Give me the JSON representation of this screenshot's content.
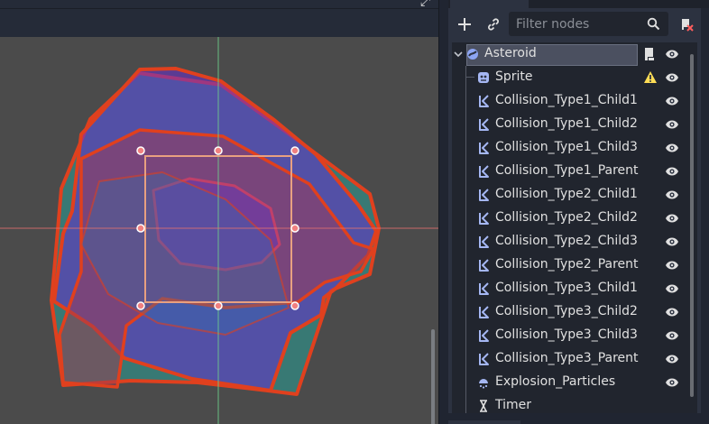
{
  "toolbar": {
    "filter_placeholder": "Filter nodes"
  },
  "tree": {
    "root": {
      "label": "Asteroid",
      "icon": "node2d-icon"
    },
    "children": [
      {
        "label": "Sprite",
        "icon": "sprite-icon",
        "warning": true
      },
      {
        "label": "Collision_Type1_Child1",
        "icon": "collision-polygon-icon"
      },
      {
        "label": "Collision_Type1_Child2",
        "icon": "collision-polygon-icon"
      },
      {
        "label": "Collision_Type1_Child3",
        "icon": "collision-polygon-icon"
      },
      {
        "label": "Collision_Type1_Parent",
        "icon": "collision-polygon-icon"
      },
      {
        "label": "Collision_Type2_Child1",
        "icon": "collision-polygon-icon"
      },
      {
        "label": "Collision_Type2_Child2",
        "icon": "collision-polygon-icon"
      },
      {
        "label": "Collision_Type2_Child3",
        "icon": "collision-polygon-icon"
      },
      {
        "label": "Collision_Type2_Parent",
        "icon": "collision-polygon-icon"
      },
      {
        "label": "Collision_Type3_Child1",
        "icon": "collision-polygon-icon"
      },
      {
        "label": "Collision_Type3_Child2",
        "icon": "collision-polygon-icon"
      },
      {
        "label": "Collision_Type3_Child3",
        "icon": "collision-polygon-icon"
      },
      {
        "label": "Collision_Type3_Parent",
        "icon": "collision-polygon-icon"
      },
      {
        "label": "Explosion_Particles",
        "icon": "particles-icon"
      },
      {
        "label": "Timer",
        "icon": "timer-icon"
      }
    ]
  },
  "colors": {
    "accent": "#699ce8",
    "polygon_outline": "#e0401e",
    "polygon_teal": "#2aa198",
    "polygon_purple": "#6a2fd0",
    "polygon_red": "#a03a50",
    "axis_x": "#e07070",
    "axis_y": "#6ed08a",
    "selection_box": "#e8a080",
    "warning": "#ffdd55"
  }
}
